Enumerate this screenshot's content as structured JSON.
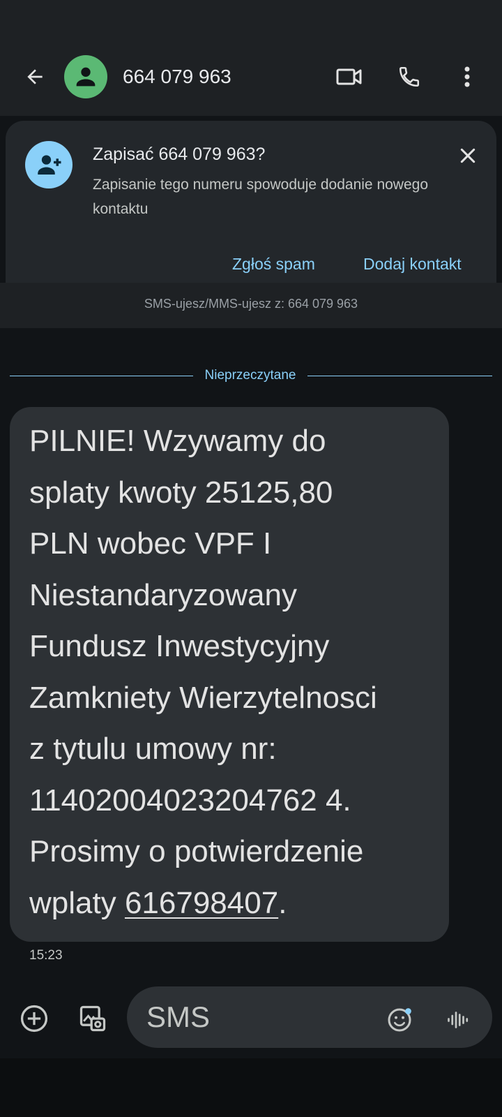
{
  "header": {
    "contact_number": "664 079 963",
    "icons": [
      "arrow-back-icon",
      "person-icon",
      "videocam-icon",
      "phone-icon",
      "more-vert-icon"
    ]
  },
  "save_card": {
    "title": "Zapisać 664 079 963?",
    "description": "Zapisanie tego numeru spowoduje dodanie nowego kontaktu",
    "spam_label": "Zgłoś spam",
    "add_contact_label": "Dodaj kontakt",
    "icons": [
      "person-add-icon",
      "close-icon"
    ]
  },
  "conversation": {
    "protocol_text": "SMS-ujesz/MMS-ujesz z: 664 079 963",
    "unread_label": "Nieprzeczytane",
    "message": {
      "body": "PILNIE! Wzywamy do splaty kwoty 25125,80 PLN wobec VPF I Niestandaryzowany Fundusz Inwestycyjny Zamkniety Wierzytelnosci z tytulu umowy nr: 11402004023204762 4. Prosimy o potwierdzenie wplaty ",
      "body_line1": "PILNIE! Wzywamy do",
      "body_line2": "splaty kwoty 25125,80",
      "body_line3": "PLN wobec VPF I",
      "body_line4": "Niestandaryzowany",
      "body_line5": "Fundusz Inwestycyjny",
      "body_line6": "Zamkniety Wierzytelnosci",
      "body_line7": "z tytulu umowy nr:",
      "body_line8": "11402004023204762 4.",
      "body_line9": "Prosimy o potwierdzenie",
      "body_line10_prefix": "wplaty ",
      "linked_number": "616798407",
      "body_line10_suffix": ".",
      "time": "15:23"
    }
  },
  "compose": {
    "placeholder": "SMS",
    "icons": [
      "add-circle-icon",
      "gallery-icon",
      "emoji-icon",
      "voice-icon"
    ]
  },
  "colors": {
    "background": "#111417",
    "header": "#1e2124",
    "bubble": "#2d3135",
    "accent": "#8ad0f9",
    "avatar_green": "#5bb974"
  }
}
